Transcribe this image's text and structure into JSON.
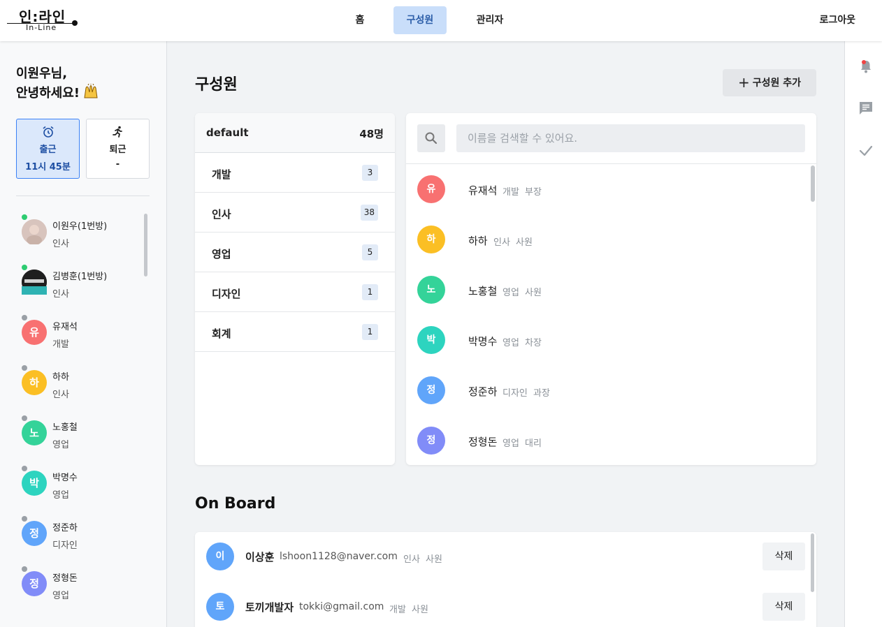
{
  "header": {
    "logo_main": "인:라인",
    "logo_sub": "In-Line",
    "nav": [
      "홈",
      "구성원",
      "관리자"
    ],
    "logout": "로그아웃"
  },
  "sidebar": {
    "greeting_line1": "이원우님,",
    "greeting_line2": "안녕하세요!",
    "checkin": {
      "label": "출근",
      "value": "11시 45분"
    },
    "checkout": {
      "label": "퇴근",
      "value": "-"
    },
    "users": [
      {
        "initial": "",
        "name": "이원우(1번방)",
        "dept": "인사",
        "online": true,
        "color": "#d8c4bd",
        "photo": true
      },
      {
        "initial": "",
        "name": "김병훈(1번방)",
        "dept": "인사",
        "online": true,
        "color": "#2b2b2b",
        "photo": true
      },
      {
        "initial": "유",
        "name": "유재석",
        "dept": "개발",
        "online": false,
        "color": "#f87171"
      },
      {
        "initial": "하",
        "name": "하하",
        "dept": "인사",
        "online": false,
        "color": "#fbbf24"
      },
      {
        "initial": "노",
        "name": "노홍철",
        "dept": "영업",
        "online": false,
        "color": "#34d399"
      },
      {
        "initial": "박",
        "name": "박명수",
        "dept": "영업",
        "online": false,
        "color": "#2dd4bf"
      },
      {
        "initial": "정",
        "name": "정준하",
        "dept": "디자인",
        "online": false,
        "color": "#60a5fa"
      },
      {
        "initial": "정",
        "name": "정형돈",
        "dept": "영업",
        "online": false,
        "color": "#818cf8"
      }
    ]
  },
  "main": {
    "title": "구성원",
    "add_button": "구성원 추가",
    "departments_header": {
      "name": "default",
      "count": "48명"
    },
    "departments": [
      {
        "name": "개발",
        "count": "3"
      },
      {
        "name": "인사",
        "count": "38"
      },
      {
        "name": "영업",
        "count": "5"
      },
      {
        "name": "디자인",
        "count": "1"
      },
      {
        "name": "회계",
        "count": "1"
      }
    ],
    "search_placeholder": "이름을 검색할 수 있어요.",
    "members": [
      {
        "initial": "유",
        "name": "유재석",
        "dept": "개발",
        "position": "부장",
        "color": "#f87171"
      },
      {
        "initial": "하",
        "name": "하하",
        "dept": "인사",
        "position": "사원",
        "color": "#fbbf24"
      },
      {
        "initial": "노",
        "name": "노홍철",
        "dept": "영업",
        "position": "사원",
        "color": "#34d399"
      },
      {
        "initial": "박",
        "name": "박명수",
        "dept": "영업",
        "position": "차장",
        "color": "#2dd4bf"
      },
      {
        "initial": "정",
        "name": "정준하",
        "dept": "디자인",
        "position": "과장",
        "color": "#60a5fa"
      },
      {
        "initial": "정",
        "name": "정형돈",
        "dept": "영업",
        "position": "대리",
        "color": "#818cf8"
      }
    ],
    "onboard_title": "On Board",
    "onboard": [
      {
        "initial": "이",
        "name": "이상훈",
        "email": "lshoon1128@naver.com",
        "dept": "인사",
        "position": "사원",
        "delete": "삭제"
      },
      {
        "initial": "토",
        "name": "토끼개발자",
        "email": "tokki@gmail.com",
        "dept": "개발",
        "position": "사원",
        "delete": "삭제"
      }
    ]
  },
  "colors": {
    "accent": "#3b82f6",
    "nav_active_bg": "#c9defa",
    "notification_dot": "#ef4444"
  }
}
